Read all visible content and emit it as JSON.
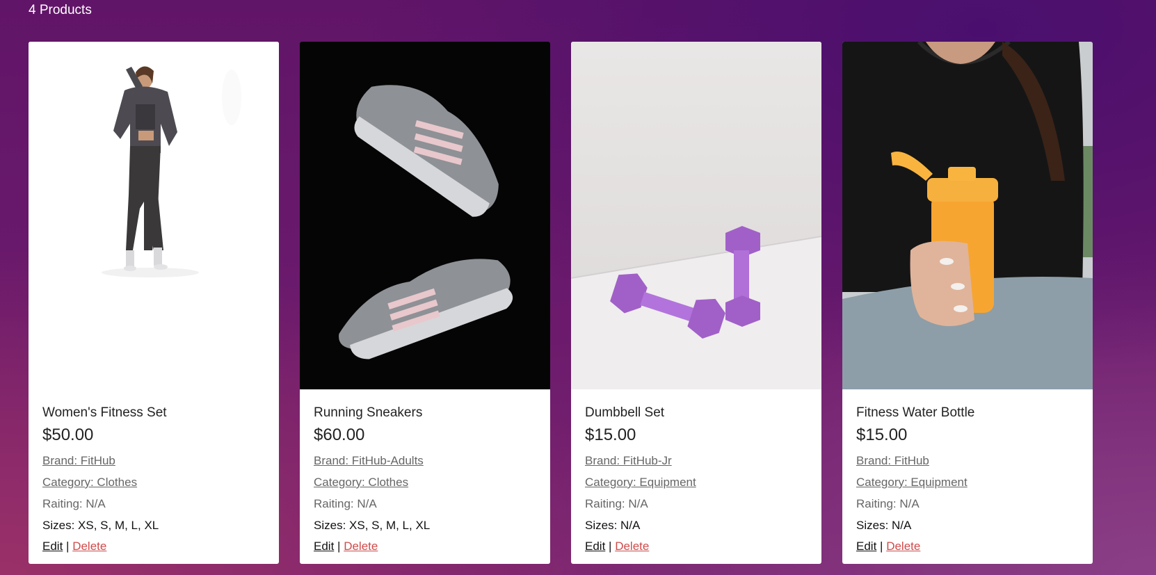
{
  "header": {
    "count_label": "4 Products"
  },
  "products": [
    {
      "name": "Women's Fitness Set",
      "price": "$50.00",
      "brand": "Brand: FitHub",
      "category": "Category: Clothes",
      "rating": "Raiting: N/A",
      "sizes_label": "Sizes:",
      "sizes": "XS, S, M, L, XL",
      "edit": "Edit",
      "separator": "|",
      "delete": "Delete",
      "image_icon": "woman-fitness-outfit-photo"
    },
    {
      "name": "Running Sneakers",
      "price": "$60.00",
      "brand": "Brand: FitHub-Adults",
      "category": "Category: Clothes",
      "rating": "Raiting: N/A",
      "sizes_label": "Sizes:",
      "sizes": "XS, S, M, L, XL",
      "edit": "Edit",
      "separator": "|",
      "delete": "Delete",
      "image_icon": "grey-sneakers-photo"
    },
    {
      "name": "Dumbbell Set",
      "price": "$15.00",
      "brand": "Brand: FitHub-Jr",
      "category": "Category: Equipment",
      "rating": "Raiting: N/A",
      "sizes_label": "Sizes:",
      "sizes": "N/A",
      "edit": "Edit",
      "separator": "|",
      "delete": "Delete",
      "image_icon": "purple-dumbbells-photo"
    },
    {
      "name": "Fitness Water Bottle",
      "price": "$15.00",
      "brand": "Brand: FitHub",
      "category": "Category: Equipment",
      "rating": "Raiting: N/A",
      "sizes_label": "Sizes:",
      "sizes": "N/A",
      "edit": "Edit",
      "separator": "|",
      "delete": "Delete",
      "image_icon": "orange-shaker-bottle-photo"
    }
  ],
  "colors": {
    "delete_link": "#d04a4a",
    "card_bg": "#ffffff",
    "page_bg": "#611568"
  }
}
